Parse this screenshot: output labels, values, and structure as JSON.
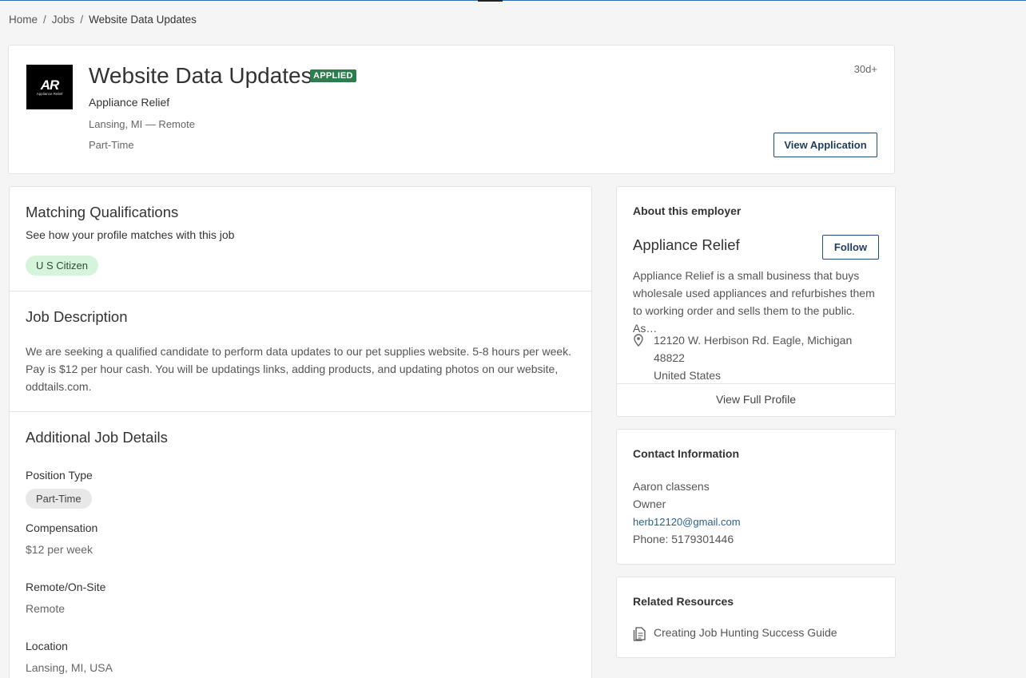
{
  "breadcrumb": {
    "home": "Home",
    "jobs": "Jobs",
    "current": "Website Data Updates",
    "separator": "/"
  },
  "job": {
    "logo_text": "AR",
    "logo_subtext": "Appliance Relief",
    "title": "Website Data Updates",
    "status_badge": "APPLIED",
    "company": "Appliance Relief",
    "location": "Lansing, MI — Remote",
    "type": "Part-Time",
    "age": "30d+",
    "view_application_label": "View Application"
  },
  "qualifications": {
    "heading": "Matching Qualifications",
    "subheading": "See how your profile matches with this job",
    "tags": [
      "U S Citizen"
    ]
  },
  "description": {
    "heading": "Job Description",
    "text": "We are seeking a qualified candidate to perform data updates to our pet supplies website. 5-8 hours per week. Pay is $12 per hour cash. You will be updatings links, adding products, and updating photos on our website, oddtails.com."
  },
  "details": {
    "heading": "Additional Job Details",
    "position_type_label": "Position Type",
    "position_type_value": "Part-Time",
    "compensation_label": "Compensation",
    "compensation_value": "$12 per week",
    "remote_label": "Remote/On-Site",
    "remote_value": "Remote",
    "location_label": "Location",
    "location_value": "Lansing, MI, USA"
  },
  "employer": {
    "heading": "About this employer",
    "name": "Appliance Relief",
    "follow_label": "Follow",
    "description": "Appliance Relief is a small business that buys wholesale used appliances and refurbishes them to working order and sells them to the public. As…",
    "address_line1": "12120 W. Herbison Rd. Eagle, Michigan 48822",
    "address_line2": "United States",
    "view_profile_label": "View Full Profile"
  },
  "contact": {
    "heading": "Contact Information",
    "name": "Aaron classens",
    "role": "Owner",
    "email": "herb12120@gmail.com",
    "phone": "Phone: 5179301446"
  },
  "resources": {
    "heading": "Related Resources",
    "items": [
      "Creating Job Hunting Success Guide"
    ]
  },
  "colors": {
    "applied_badge": "#2e7d4f",
    "qualification_pill": "#d4f5dc",
    "link": "#2d5f8f",
    "button_border": "#1f4d7a"
  }
}
